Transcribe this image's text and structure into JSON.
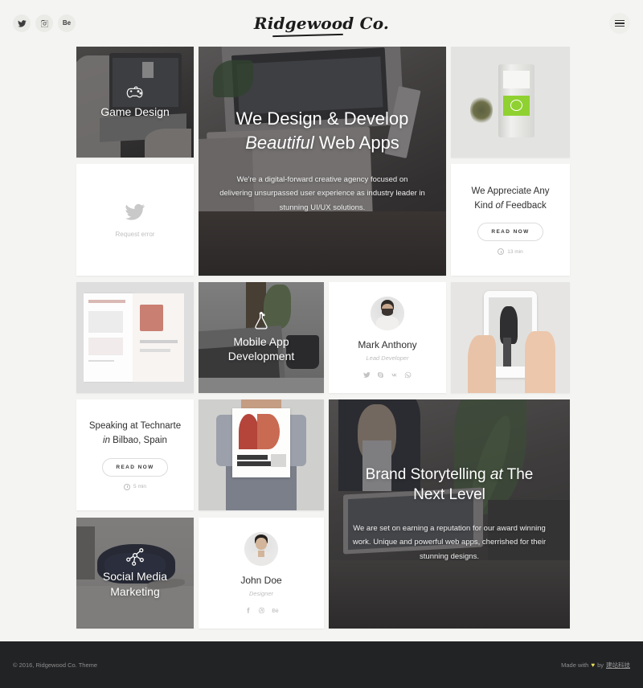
{
  "header": {
    "brand": "Ridgewood Co.",
    "social": [
      {
        "name": "twitter",
        "label": "Twitter"
      },
      {
        "name": "instagram",
        "label": "Instagram"
      },
      {
        "name": "behance",
        "label": "Be"
      }
    ],
    "menu_label": "Menu"
  },
  "tiles": {
    "game_design": {
      "title": "Game Design",
      "icon": "gamepad-icon"
    },
    "twitter_widget": {
      "message": "Request error",
      "icon": "twitter-bird-icon"
    },
    "hero_main": {
      "title_line1": "We Design & Develop",
      "title_em": "Beautiful",
      "title_line2_rest": " Web Apps",
      "body": "We're a digital-forward creative agency focused on delivering unsurpassed user experience as industry leader in stunning UI/UX solutions."
    },
    "product_photo": {
      "alt": "Tea tin packaging with loose leaf tea"
    },
    "feedback": {
      "title_a": "We Appreciate Any",
      "title_b": "Kind ",
      "title_em": "of",
      "title_c": " Feedback",
      "button": "READ NOW",
      "read_time": "13 min"
    },
    "magazine_photo": {
      "alt": "Open magazine spread mockup"
    },
    "mobile_app": {
      "title_line1": "Mobile App",
      "title_line2": "Development",
      "icon": "flask-icon"
    },
    "mark_anthony": {
      "name": "Mark Anthony",
      "role": "Lead Developer",
      "social": [
        "twitter",
        "skype",
        "vk",
        "whatsapp"
      ]
    },
    "phone_photo": {
      "alt": "Hand holding a smartphone showing an ostrich"
    },
    "technarte": {
      "title_a": "Speaking at Technarte",
      "title_em": "in",
      "title_b": " Bilbao, Spain",
      "button": "READ NOW",
      "read_time": "5 min"
    },
    "poster_photo": {
      "alt": "Person holding AB A3 poster"
    },
    "hero_brand": {
      "title_line1a": "Brand Storytelling ",
      "title_em": "at",
      "title_line1b": " The",
      "title_line2": "Next Level",
      "body": "We are set on earning a reputation for our award winning work. Unique and powerful web apps, cherrished for their stunning designs."
    },
    "social_media": {
      "title_line1": "Social Media",
      "title_line2": "Marketing",
      "icon": "share-network-icon"
    },
    "john_doe": {
      "name": "John Doe",
      "role": "Designer",
      "social": [
        "facebook",
        "dribbble",
        "behance"
      ]
    }
  },
  "footer": {
    "copyright": "© 2016, Ridgewood Co. Theme",
    "made_with": "Made with",
    "by": "by",
    "author": "建站科技"
  },
  "colors": {
    "page_bg": "#f4f4f2",
    "card_bg": "#ffffff",
    "footer_bg": "#222325",
    "text": "#2f2f2f",
    "muted": "#bdbdbd"
  }
}
